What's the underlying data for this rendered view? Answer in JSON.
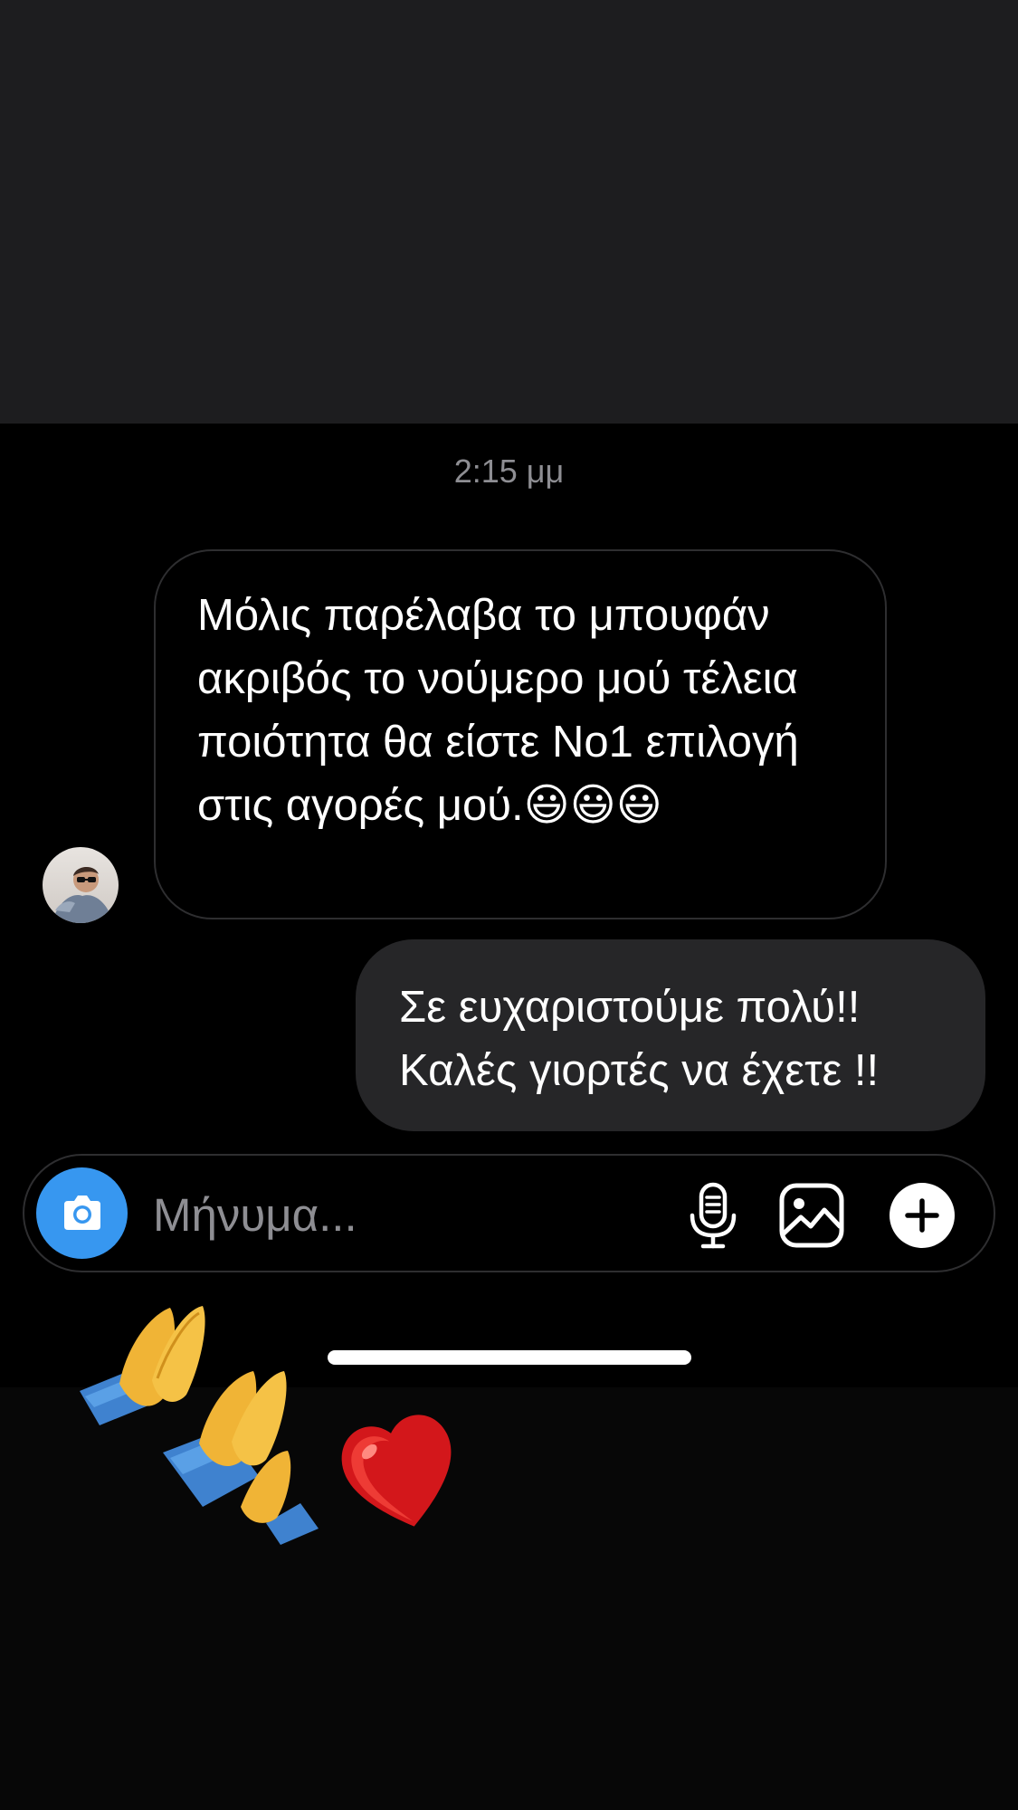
{
  "conversation": {
    "timestamp": "2:15 μμ",
    "messages": [
      {
        "direction": "incoming",
        "text": "Μόλις παρέλαβα το μπουφάν ακριβός το νούμερο μού τέλεια ποιότητα θα είστε Νο1 επιλογή στις αγορές μού.😃😃😃"
      },
      {
        "direction": "outgoing",
        "text": "Σε ευχαριστούμε πολύ!! Καλές γιορτές να έχετε !!"
      }
    ]
  },
  "composer": {
    "placeholder": "Μήνυμα...",
    "camera_icon": "camera-icon",
    "mic_icon": "microphone-icon",
    "gallery_icon": "image-gallery-icon",
    "plus_icon": "plus-icon",
    "camera_color": "#3797f0"
  },
  "sticker": {
    "icons": [
      "praying-hands-icon",
      "praying-hands-icon",
      "red-heart-icon"
    ]
  }
}
